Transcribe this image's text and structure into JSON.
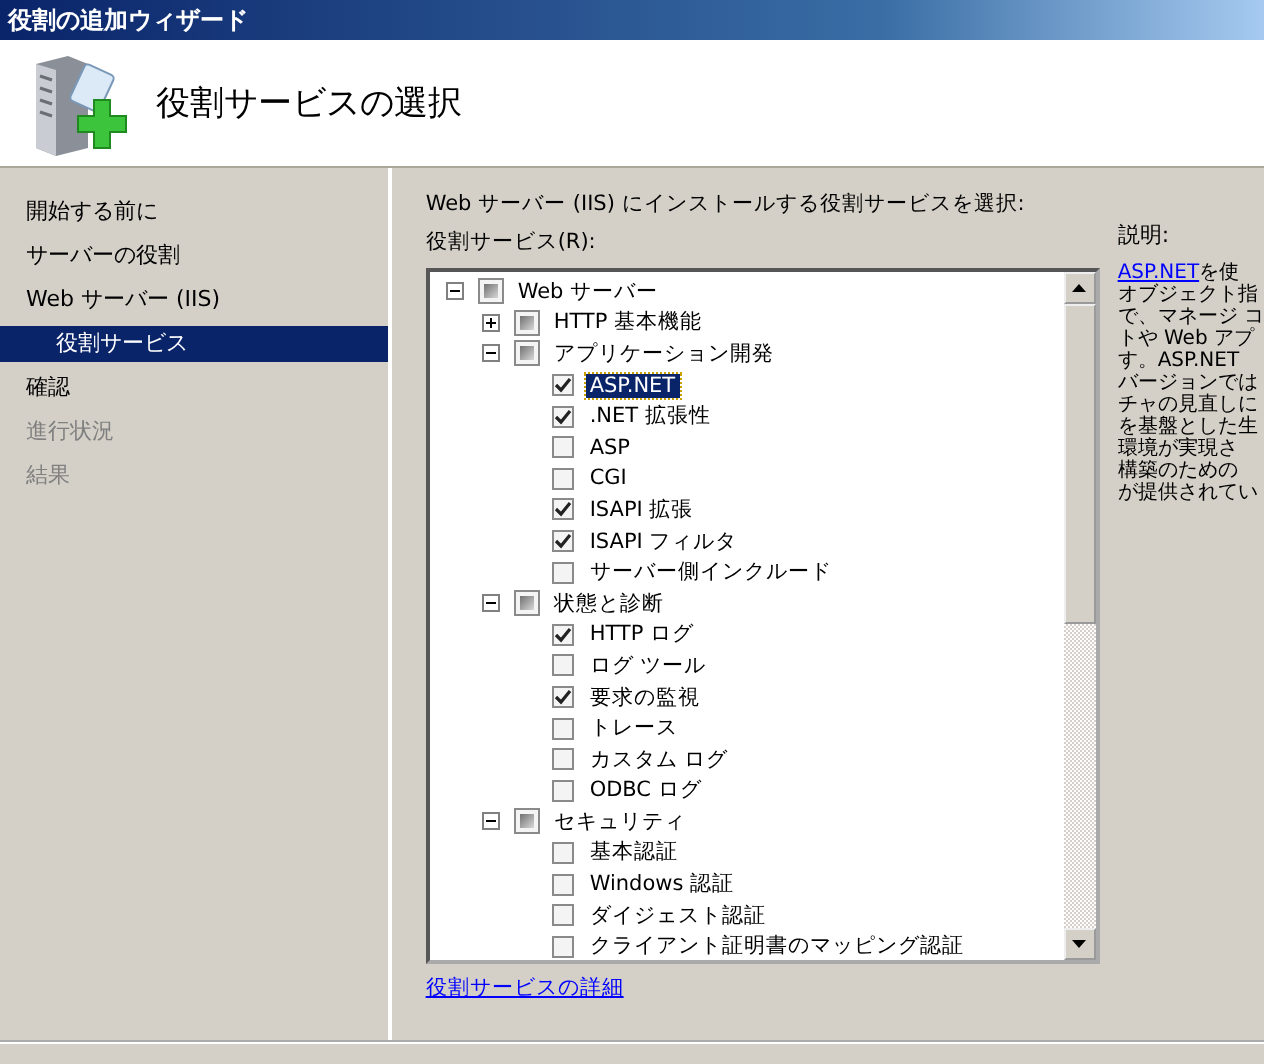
{
  "window": {
    "title": "役割の追加ウィザード"
  },
  "header": {
    "title": "役割サービスの選択"
  },
  "sidebar": {
    "items": [
      {
        "label": "開始する前に",
        "selected": false,
        "disabled": false,
        "sub": false
      },
      {
        "label": "サーバーの役割",
        "selected": false,
        "disabled": false,
        "sub": false
      },
      {
        "label": "Web サーバー (IIS)",
        "selected": false,
        "disabled": false,
        "sub": false
      },
      {
        "label": "役割サービス",
        "selected": true,
        "disabled": false,
        "sub": true
      },
      {
        "label": "確認",
        "selected": false,
        "disabled": false,
        "sub": false
      },
      {
        "label": "進行状況",
        "selected": false,
        "disabled": true,
        "sub": false
      },
      {
        "label": "結果",
        "selected": false,
        "disabled": true,
        "sub": false
      }
    ]
  },
  "content": {
    "instruction": "Web サーバー (IIS) にインストールする役割サービスを選択:",
    "list_label": "役割サービス(R):",
    "tree": [
      {
        "label": "Web サーバー",
        "checked": false,
        "mixed": true,
        "expanded": true,
        "selected": false,
        "children": [
          {
            "label": "HTTP 基本機能",
            "checked": false,
            "mixed": true,
            "expanded": false,
            "selected": false
          },
          {
            "label": "アプリケーション開発",
            "checked": false,
            "mixed": true,
            "expanded": true,
            "selected": false,
            "children": [
              {
                "label": "ASP.NET",
                "checked": true,
                "selected": true
              },
              {
                "label": ".NET 拡張性",
                "checked": true,
                "selected": false
              },
              {
                "label": "ASP",
                "checked": false,
                "selected": false
              },
              {
                "label": "CGI",
                "checked": false,
                "selected": false
              },
              {
                "label": "ISAPI 拡張",
                "checked": true,
                "selected": false
              },
              {
                "label": "ISAPI フィルタ",
                "checked": true,
                "selected": false
              },
              {
                "label": "サーバー側インクルード",
                "checked": false,
                "selected": false
              }
            ]
          },
          {
            "label": "状態と診断",
            "checked": false,
            "mixed": true,
            "expanded": true,
            "selected": false,
            "children": [
              {
                "label": "HTTP ログ",
                "checked": true,
                "selected": false
              },
              {
                "label": "ログ ツール",
                "checked": false,
                "selected": false
              },
              {
                "label": "要求の監視",
                "checked": true,
                "selected": false
              },
              {
                "label": "トレース",
                "checked": false,
                "selected": false
              },
              {
                "label": "カスタム ログ",
                "checked": false,
                "selected": false
              },
              {
                "label": "ODBC ログ",
                "checked": false,
                "selected": false
              }
            ]
          },
          {
            "label": "セキュリティ",
            "checked": false,
            "mixed": true,
            "expanded": true,
            "selected": false,
            "children": [
              {
                "label": "基本認証",
                "checked": false,
                "selected": false
              },
              {
                "label": "Windows 認証",
                "checked": false,
                "selected": false
              },
              {
                "label": "ダイジェスト認証",
                "checked": false,
                "selected": false
              },
              {
                "label": "クライアント証明書のマッピング認証",
                "checked": false,
                "selected": false
              }
            ]
          }
        ]
      }
    ],
    "details_link": "役割サービスの詳細"
  },
  "description": {
    "label": "説明:",
    "link": "ASP.NET",
    "lines": [
      "を使",
      "オブジェクト指",
      "で、マネージ コ",
      "トや Web アプ",
      "す。ASP.NET",
      "バージョンでは",
      "チャの見直しに",
      "を基盤とした生",
      "環境が実現さ",
      "構築のための",
      "が提供されてい"
    ]
  }
}
